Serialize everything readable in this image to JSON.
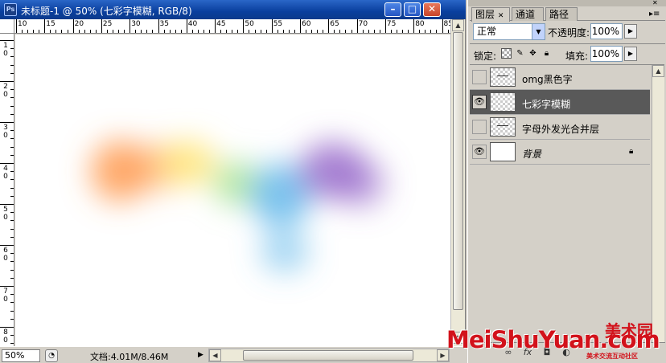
{
  "document": {
    "title": "未标题-1 @ 50% (七彩字模糊, RGB/8)",
    "app_icon": "Ps",
    "window_buttons": [
      "minimize-icon",
      "maximize-icon",
      "close-icon"
    ],
    "ruler_top_labels": [
      "10",
      "15",
      "20",
      "25",
      "30",
      "35",
      "40",
      "45",
      "50",
      "55",
      "60",
      "65",
      "70",
      "75",
      "80",
      "85"
    ],
    "ruler_left_labels": [
      "1\n0",
      "2\n0",
      "3\n0",
      "4\n0",
      "5\n0",
      "6\n0",
      "7\n0",
      "8\n0"
    ],
    "status": {
      "zoom": "50%",
      "doc_info": "文档:4.01M/8.46M"
    },
    "blur_colors": [
      "#ff9a50",
      "#ffe36a",
      "#9fe08a",
      "#5ab4ea",
      "#9a6ccb"
    ]
  },
  "layers_panel": {
    "tabs": [
      {
        "label": "图层",
        "active": true
      },
      {
        "label": "通道",
        "active": false
      },
      {
        "label": "路径",
        "active": false
      }
    ],
    "blend_mode": "正常",
    "opacity_label": "不透明度:",
    "opacity_value": "100%",
    "lock_label": "锁定:",
    "fill_label": "填充:",
    "fill_value": "100%",
    "layers": [
      {
        "name": "omg黑色字",
        "visible": false,
        "selected": false,
        "italic": false
      },
      {
        "name": "七彩字模糊",
        "visible": true,
        "selected": true,
        "italic": false
      },
      {
        "name": "字母外发光合并层",
        "visible": false,
        "selected": false,
        "italic": false
      },
      {
        "name": "背景",
        "visible": true,
        "selected": false,
        "italic": true,
        "locked": true
      }
    ],
    "bottom_icons": [
      "link-icon",
      "fx-icon",
      "mask-icon",
      "adjustment-icon"
    ]
  },
  "watermark": {
    "main": "MeiShuYuan.com",
    "cn": "美术园",
    "sub": "美术交流互动社区"
  }
}
